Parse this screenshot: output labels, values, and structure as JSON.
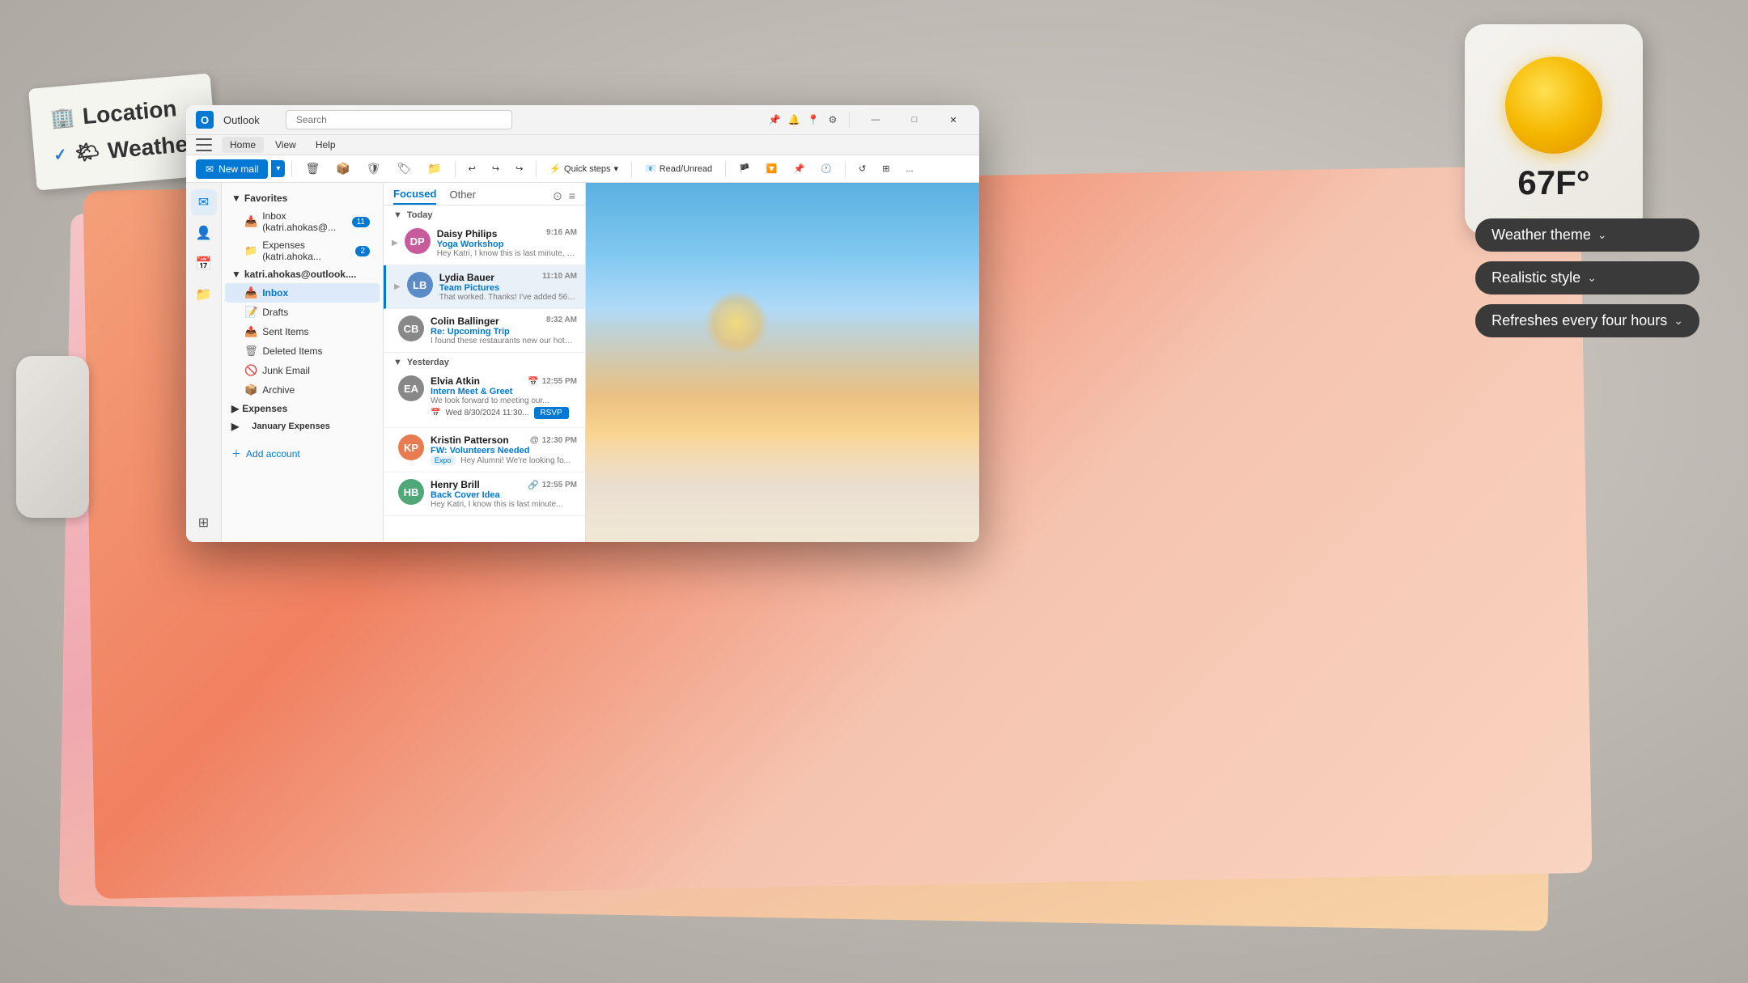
{
  "background": {
    "color": "#c8c4bc"
  },
  "sticky_note": {
    "location_label": "Location",
    "weather_label": "Weather",
    "location_icon": "🏢",
    "weather_icon": "🌤"
  },
  "weather_widget": {
    "temperature": "67F°",
    "icon_label": "sun-icon"
  },
  "weather_settings": {
    "theme_label": "Weather theme",
    "style_label": "Realistic style",
    "refresh_label": "Refreshes every four hours",
    "chevron": "⌄"
  },
  "outlook": {
    "title": "Outlook",
    "search_placeholder": "Search",
    "window_controls": {
      "minimize": "—",
      "maximize": "□",
      "close": "✕"
    },
    "menu": {
      "home": "Home",
      "view": "View",
      "help": "Help"
    },
    "toolbar": {
      "new_mail": "New mail",
      "quick_steps": "Quick steps",
      "read_unread": "Read/Unread",
      "more": "..."
    },
    "nav_icons": [
      {
        "id": "mail",
        "icon": "✉",
        "active": true
      },
      {
        "id": "people",
        "icon": "👤",
        "active": false
      },
      {
        "id": "calendar",
        "icon": "📅",
        "active": false
      },
      {
        "id": "files",
        "icon": "📁",
        "active": false
      },
      {
        "id": "apps",
        "icon": "⊞",
        "active": false
      }
    ],
    "sidebar": {
      "favorites_label": "Favorites",
      "accounts": [
        {
          "name": "katri.ahokas@outlook....",
          "folders": [
            {
              "name": "Inbox",
              "badge": "11",
              "active": false,
              "icon": "inbox"
            },
            {
              "name": "Expenses (katri.ahoka...",
              "badge": "2",
              "active": false,
              "icon": "folder"
            }
          ]
        }
      ],
      "main_account": "katri.ahokas@outlook....",
      "folders": [
        {
          "name": "Inbox",
          "icon": "📥",
          "active": true
        },
        {
          "name": "Drafts",
          "icon": "📝",
          "active": false
        },
        {
          "name": "Sent Items",
          "icon": "📤",
          "active": false
        },
        {
          "name": "Deleted Items",
          "icon": "🗑",
          "active": false
        },
        {
          "name": "Junk Email",
          "icon": "🚫",
          "active": false
        },
        {
          "name": "Archive",
          "icon": "📦",
          "active": false
        },
        {
          "name": "Expenses",
          "icon": "📁",
          "active": false
        },
        {
          "name": "January Expenses",
          "icon": "📁",
          "active": false
        }
      ],
      "add_account_label": "Add account"
    },
    "email_list": {
      "tabs": [
        {
          "label": "Focused",
          "active": true
        },
        {
          "label": "Other",
          "active": false
        }
      ],
      "groups": [
        {
          "label": "Today",
          "emails": [
            {
              "sender": "Daisy Philips",
              "subject": "Yoga Workshop",
              "preview": "Hey Katri, I know this is last minute, bu...",
              "time": "9:16 AM",
              "avatar_color": "#c75b9b",
              "avatar_initials": "DP",
              "active": false
            },
            {
              "sender": "Lydia Bauer",
              "subject": "Team Pictures",
              "preview": "That worked. Thanks! I've added 56 of...",
              "time": "11:10 AM",
              "avatar_color": "#5b8cc7",
              "avatar_initials": "LB",
              "active": true
            },
            {
              "sender": "Colin Ballinger",
              "subject": "Re: Upcoming Trip",
              "preview": "I found these restaurants new our hotel...",
              "time": "8:32 AM",
              "avatar_color": "#777",
              "avatar_initials": "CB",
              "active": false
            }
          ]
        },
        {
          "label": "Yesterday",
          "emails": [
            {
              "sender": "Elvia Atkin",
              "subject": "Intern Meet & Greet",
              "preview": "We look forward to meeting our...",
              "time": "12:55 PM",
              "avatar_color": "#888",
              "avatar_initials": "EA",
              "has_calendar": true,
              "event_date": "Wed 8/30/2024 11:30...",
              "rsvp_label": "RSVP",
              "active": false
            },
            {
              "sender": "Kristin Patterson",
              "subject": "FW: Volunteers Needed",
              "preview": "Hey Alumni! We're looking fo...",
              "time": "12:30 PM",
              "avatar_color": "#e87c50",
              "avatar_initials": "KP",
              "has_at": true,
              "tag": "Expo",
              "active": false
            },
            {
              "sender": "Henry Brill",
              "subject": "Back Cover Idea",
              "preview": "Hey Katri, I know this is last minute...",
              "time": "12:55 PM",
              "avatar_color": "#50a878",
              "avatar_initials": "HB",
              "has_link": true,
              "active": false
            }
          ]
        }
      ]
    }
  }
}
